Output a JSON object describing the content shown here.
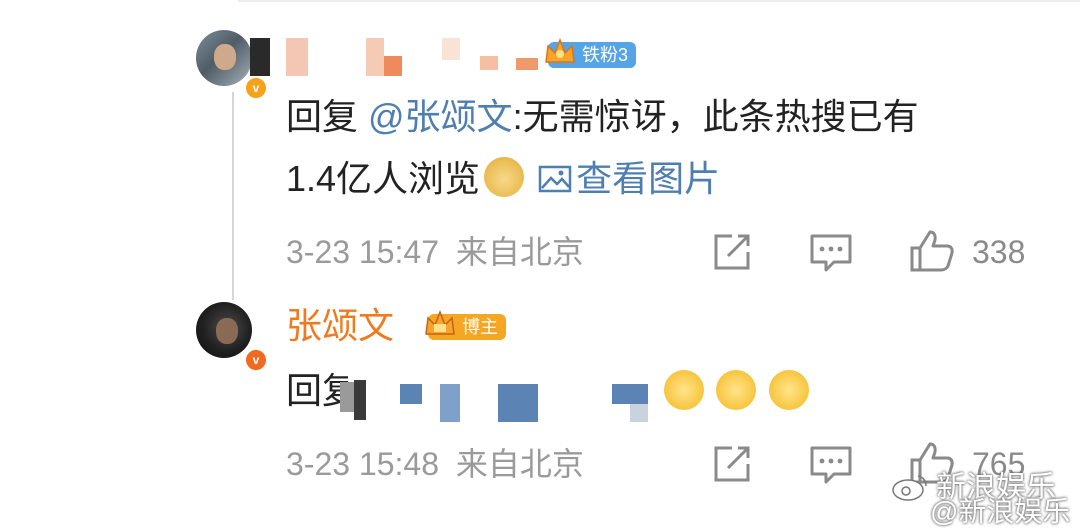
{
  "comment1": {
    "badge_label": "铁粉3",
    "text_line1_prefix": "回复 ",
    "mention": "@张颂文",
    "text_line1_suffix": ":无需惊讶，此条热搜已有",
    "text_line2": "1.4亿人浏览",
    "emoji_icon": "doge-emoji-icon",
    "view_image_label": "查看图片",
    "timestamp": "3-23 15:47",
    "source": "来自北京",
    "like_count": "338"
  },
  "comment2": {
    "username": "张颂文",
    "badge_label": "博主",
    "text_prefix": "回复",
    "emoji_icons": [
      "smile-emoji-icon",
      "smile-emoji-icon",
      "smile-emoji-icon"
    ],
    "timestamp": "3-23 15:48",
    "source": "来自北京",
    "like_count": "765"
  },
  "watermarks": [
    "新浪娱乐",
    "@新浪娱乐"
  ],
  "colors": {
    "username": "#f07a1e",
    "link": "#4f7eb0",
    "meta": "#9a9a9a",
    "fan_badge": "#55a4e6",
    "blogger_badge": "#f5a623"
  }
}
